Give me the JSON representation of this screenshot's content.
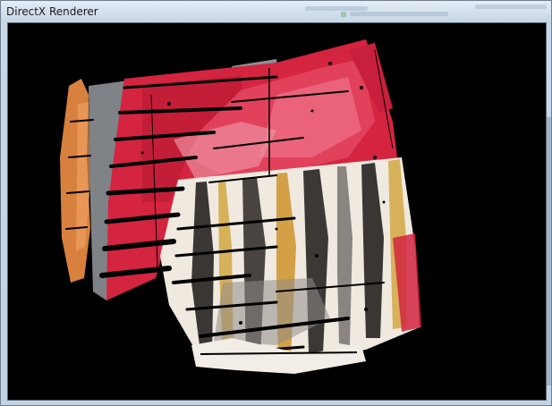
{
  "window": {
    "title": "DirectX Renderer"
  },
  "scene": {
    "description_icon": "3d-point-cloud-render",
    "colors": {
      "background": "#000000",
      "red": "#d9243f",
      "pink": "#e85a78",
      "orange": "#e8904a",
      "gray": "#8a8f95",
      "stripe_white": "#f1ede6",
      "stripe_dark": "#3a3634",
      "stripe_yellow": "#d8b25a"
    }
  }
}
